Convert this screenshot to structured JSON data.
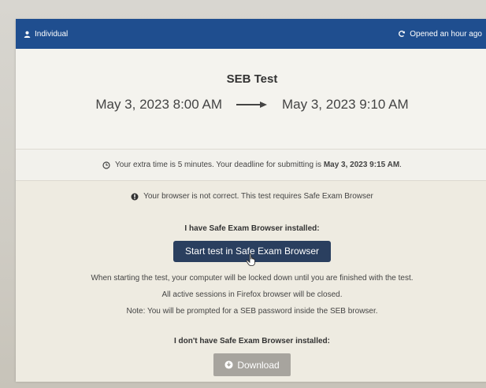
{
  "header": {
    "user_label": "Individual",
    "status_label": "Opened an hour ago",
    "user_icon": "person-icon",
    "status_icon": "refresh-icon",
    "bar_color": "#1f4e8f"
  },
  "test": {
    "title": "SEB Test",
    "start": "May 3, 2023 8:00 AM",
    "end": "May 3, 2023 9:10 AM"
  },
  "extra_time": {
    "text": "Your extra time is 5 minutes. Your deadline for submitting is",
    "deadline": "May 3, 2023 9:15 AM",
    "suffix": ".",
    "icon": "clock-icon"
  },
  "warning": {
    "text": "Your browser is not correct. This test requires Safe Exam Browser",
    "icon": "exclamation-circle-icon"
  },
  "installed": {
    "heading": "I have Safe Exam Browser installed:",
    "button_label": "Start test in Safe Exam Browser",
    "notes": [
      "When starting the test, your computer will be locked down until you are finished with the test.",
      "All active sessions in Firefox browser will be closed.",
      "Note: You will be prompted for a SEB password inside the SEB browser."
    ]
  },
  "not_installed": {
    "heading": "I don't have Safe Exam Browser installed:",
    "button_label": "Download",
    "icon": "download-circle-icon"
  }
}
